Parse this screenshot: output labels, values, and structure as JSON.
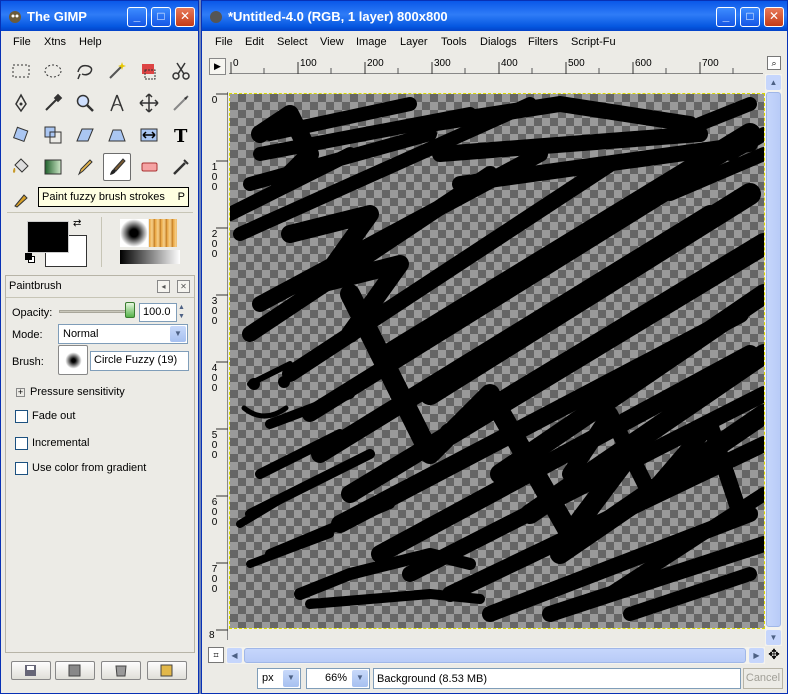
{
  "toolbox": {
    "title": "The GIMP",
    "menu": [
      "File",
      "Xtns",
      "Help"
    ],
    "tooltip": {
      "text": "Paint fuzzy brush strokes",
      "shortcut": "P"
    },
    "tools": [
      "rect-select-icon",
      "ellipse-select-icon",
      "free-select-icon",
      "fuzzy-select-icon",
      "color-select-icon",
      "scissors-icon",
      "paths-icon",
      "color-picker-icon",
      "zoom-icon",
      "measure-icon",
      "move-icon",
      "crop-icon",
      "rotate-icon",
      "scale-icon",
      "shear-icon",
      "perspective-icon",
      "flip-icon",
      "text-icon",
      "bucket-fill-icon",
      "blend-icon",
      "pencil-icon",
      "paintbrush-icon",
      "eraser-icon",
      "airbrush-icon",
      "ink-icon"
    ],
    "colors": {
      "foreground": "#000000",
      "background": "#ffffff"
    },
    "panel": {
      "title": "Paintbrush",
      "opacity_label": "Opacity:",
      "opacity_value": "100.0",
      "opacity_fraction": 1.0,
      "mode_label": "Mode:",
      "mode_value": "Normal",
      "brush_label": "Brush:",
      "brush_value": "Circle Fuzzy (19)",
      "pressure": "Pressure sensitivity",
      "fade_out": "Fade out",
      "incremental": "Incremental",
      "use_gradient": "Use color from gradient"
    }
  },
  "image_window": {
    "title": "*Untitled-4.0 (RGB, 1 layer) 800x800",
    "menu": [
      "File",
      "Edit",
      "Select",
      "View",
      "Image",
      "Layer",
      "Tools",
      "Dialogs",
      "Filters",
      "Script-Fu"
    ],
    "h_ruler": [
      "0",
      "100",
      "200",
      "300",
      "400",
      "500",
      "600",
      "700"
    ],
    "v_ruler": [
      "0",
      "100",
      "200",
      "300",
      "400",
      "500",
      "600",
      "700",
      "8"
    ],
    "unit": "px",
    "zoom": "66%",
    "status": "Background (8.53 MB)",
    "cancel": "Cancel"
  }
}
